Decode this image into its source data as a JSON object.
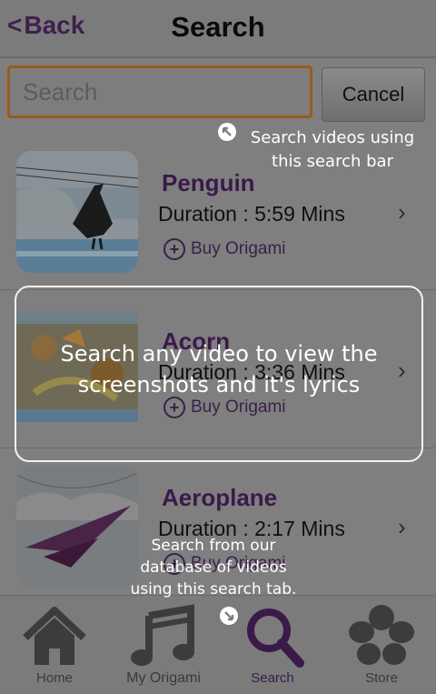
{
  "header": {
    "back_label": "Back",
    "title": "Search"
  },
  "search": {
    "placeholder": "Search",
    "cancel_label": "Cancel"
  },
  "items": [
    {
      "name": "Penguin",
      "duration": "Duration : 5:59 Mins",
      "buy_label": "Buy Origami"
    },
    {
      "name": "Acorn",
      "duration": "Duration : 3:36 Mins",
      "buy_label": "Buy Origami"
    },
    {
      "name": "Aeroplane",
      "duration": "Duration : 2:17 Mins",
      "buy_label": "Buy Origami"
    }
  ],
  "tabs": [
    {
      "label": "Home",
      "icon": "home-icon",
      "active": false
    },
    {
      "label": "My Origami",
      "icon": "music-note-icon",
      "active": false
    },
    {
      "label": "Search",
      "icon": "search-icon",
      "active": true
    },
    {
      "label": "Store",
      "icon": "hibiscus-flower-icon",
      "active": false
    }
  ],
  "coach_marks": {
    "search_bar_hint": [
      "Search videos using",
      "this search bar"
    ],
    "center_hint": [
      "Search any video to view the",
      "screenshots and it's lyrics"
    ],
    "tab_hint": [
      "Search from our",
      "database of videos",
      "using this search tab."
    ]
  },
  "colors": {
    "accent": "#3a1a4a",
    "search_border": "#9a5b1a",
    "overlay_dim": "#7f7f7f"
  }
}
